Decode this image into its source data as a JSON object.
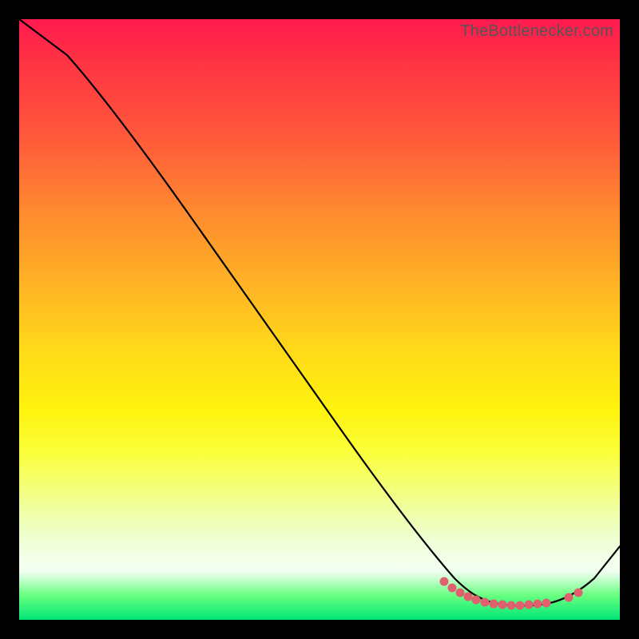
{
  "watermark": "TheBottlenecker.com",
  "chart_data": {
    "type": "line",
    "title": "",
    "xlabel": "",
    "ylabel": "",
    "xlim": [
      0,
      100
    ],
    "ylim": [
      0,
      100
    ],
    "series": [
      {
        "name": "bottleneck-curve",
        "x": [
          0,
          7,
          14,
          21,
          28,
          35,
          42,
          49,
          56,
          63,
          70,
          73,
          76,
          79,
          82,
          85,
          88,
          91,
          94,
          97,
          100
        ],
        "y": [
          100,
          94,
          85,
          76,
          67,
          58,
          49,
          40,
          31,
          22,
          13,
          9,
          6,
          4,
          3,
          3,
          3,
          4,
          6,
          9,
          13
        ]
      }
    ],
    "markers": {
      "x": [
        70,
        72,
        74,
        76,
        78,
        80,
        82,
        84,
        86,
        88,
        91,
        93
      ],
      "y": [
        13,
        10,
        8,
        6,
        5,
        4,
        3,
        3,
        3,
        3,
        4,
        6
      ]
    },
    "gradient_stops": [
      {
        "pos": 0,
        "color": "#ff1a4f"
      },
      {
        "pos": 50,
        "color": "#ffd500"
      },
      {
        "pos": 92,
        "color": "#f5ffe8"
      },
      {
        "pos": 100,
        "color": "#00e676"
      }
    ]
  }
}
